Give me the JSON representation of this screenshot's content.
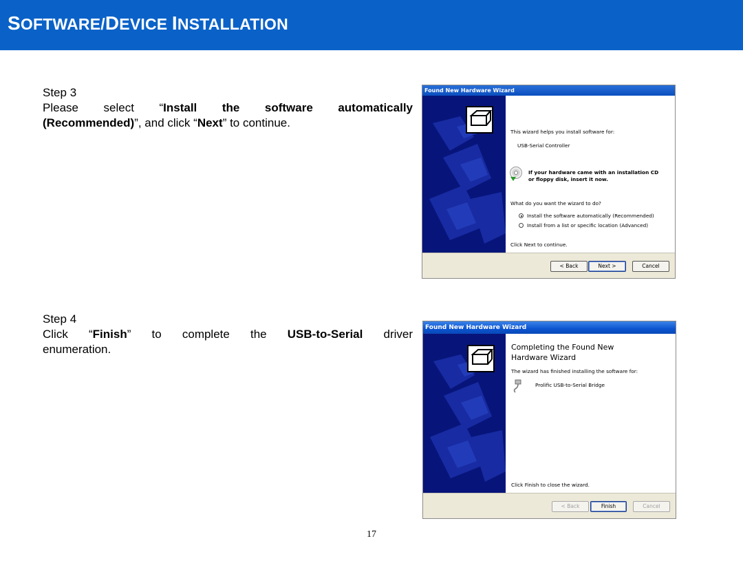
{
  "header": {
    "title_parts": [
      {
        "text": "S",
        "big": true
      },
      {
        "text": "OFTWARE/",
        "big": false
      },
      {
        "text": "D",
        "big": true
      },
      {
        "text": "EVICE ",
        "big": false
      },
      {
        "text": "I",
        "big": true
      },
      {
        "text": "NSTALLATION",
        "big": false
      }
    ],
    "bg_color": "#0a62c8"
  },
  "step3": {
    "label": "Step 3",
    "line1_pre": "Please select “",
    "line1_bold": "Install the software automatically",
    "line2_bold": "(Recommended)",
    "line2_mid": "”, and click “",
    "line2_bold2": "Next",
    "line2_post": "” to continue."
  },
  "step4": {
    "label": "Step 4",
    "line1_pre": "Click “",
    "line1_bold": "Finish",
    "line1_mid": "” to complete the ",
    "line1_bold2": "USB-to-Serial",
    "line1_post": " driver",
    "line2": "enumeration."
  },
  "wizard1": {
    "title": "Found New Hardware Wizard",
    "intro": "This wizard helps you install software for:",
    "device": "USB-Serial Controller",
    "cd_line1": "If your hardware came with an installation CD",
    "cd_line2": "or floppy disk, insert it now.",
    "question": "What do you want the wizard to do?",
    "options": [
      {
        "label": "Install the software automatically (Recommended)",
        "selected": true
      },
      {
        "label": "Install from a list or specific location (Advanced)",
        "selected": false
      }
    ],
    "footer_note": "Click Next to continue.",
    "buttons": {
      "back": "< Back",
      "next": "Next >",
      "cancel": "Cancel"
    }
  },
  "wizard2": {
    "title": "Found New Hardware Wizard",
    "heading_line1": "Completing the Found New",
    "heading_line2": "Hardware Wizard",
    "finished_text": "The wizard has finished installing the software for:",
    "device": "Prolific USB-to-Serial Bridge",
    "footer_note": "Click Finish to close the wizard.",
    "buttons": {
      "back": "< Back",
      "finish": "Finish",
      "cancel": "Cancel"
    }
  },
  "page_number": "17"
}
